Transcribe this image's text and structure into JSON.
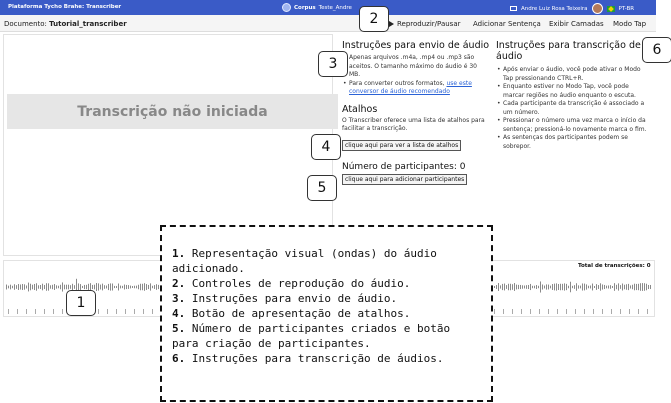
{
  "topbar": {
    "brand": "Plataforma Tycho Brahe: Transcriber",
    "corpus_label": "Corpus",
    "corpus_name": "Teste_Andre",
    "user_name": "Andre Luiz Rosa Teixeira",
    "locale": "PT-BR",
    "color": "#3a5bc7"
  },
  "docbar": {
    "doc_label": "Documento:",
    "doc_name": "Tutorial_transcriber",
    "play_label": "Reproduzir/Pausar",
    "add_sentence": "Adicionar Sentença",
    "show_layers": "Exibir Camadas",
    "tap_mode": "Modo Tap"
  },
  "main": {
    "not_started": "Transcrição não iniciada"
  },
  "upload": {
    "title": "Instruções para envio de áudio",
    "bullet1": "Apenas arquivos .m4a, .mp4 ou .mp3 são aceitos. O tamanho máximo do áudio é 30 MB.",
    "bullet2_prefix": "Para converter outros formatos,",
    "bullet2_link": "use este conversor de áudio recomendado"
  },
  "shortcuts": {
    "title": "Atalhos",
    "text": "O Transcriber oferece uma lista de atalhos para facilitar a transcrição.",
    "button": "clique aqui para ver a lista de atalhos"
  },
  "participants": {
    "title": "Número de participantes: 0",
    "button": "clique aqui para adicionar participantes"
  },
  "transcription": {
    "title": "Instruções para transcrição de áudio",
    "bullets": [
      "Após enviar o áudio, você pode ativar o Modo Tap pressionando CTRL+R.",
      "Enquanto estiver no Modo Tap, você pode marcar regiões no áudio enquanto o escuta.",
      "Cada participante da transcrição é associado a um número.",
      "Pressionar o número uma vez marca o início da sentença; pressioná-lo novamente marca o fim.",
      "As sentenças dos participantes podem se sobrepor."
    ]
  },
  "waveform": {
    "total_label": "Total de transcrições: 0"
  },
  "callouts": [
    "1",
    "2",
    "3",
    "4",
    "5",
    "6"
  ],
  "legend": {
    "items": [
      {
        "num": "1.",
        "text": "Representação visual (ondas) do áudio adicionado."
      },
      {
        "num": "2.",
        "text": "Controles de reprodução do áudio."
      },
      {
        "num": "3.",
        "text": "Instruções para envio de áudio."
      },
      {
        "num": "4.",
        "text": "Botão de apresentação de atalhos."
      },
      {
        "num": "5.",
        "text": "Número de participantes criados e botão para criação de participantes."
      },
      {
        "num": "6.",
        "text": "Instruções para transcrição de áudios."
      }
    ]
  }
}
